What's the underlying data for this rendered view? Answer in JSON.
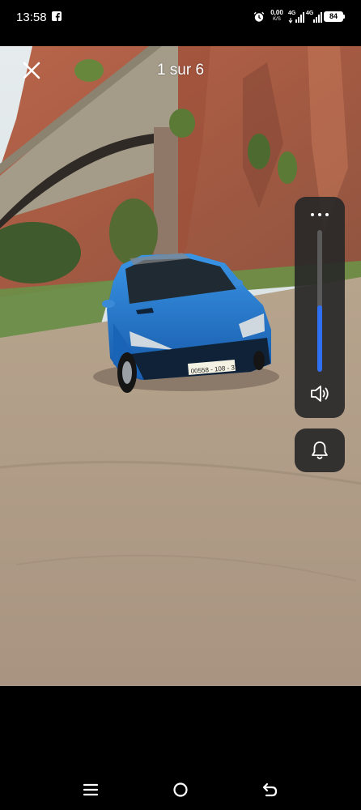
{
  "status_bar": {
    "time": "13:58",
    "speed_value": "0,00",
    "speed_unit": "K/S",
    "signal_1_label": "4G",
    "signal_2_label": "4G",
    "battery": "84"
  },
  "viewer": {
    "counter": "1 sur 6",
    "volume_level": 0.47
  },
  "photo": {
    "plate": "00558 - 108 - 37"
  },
  "icons": {
    "close": "close-icon",
    "more": "more-icon",
    "volume": "speaker-icon",
    "ringer": "bell-icon",
    "menu": "menu-icon",
    "home": "home-icon",
    "back": "back-icon"
  },
  "colors": {
    "volume_fill": "#2f6ff2",
    "car_body": "#1f74c9"
  }
}
